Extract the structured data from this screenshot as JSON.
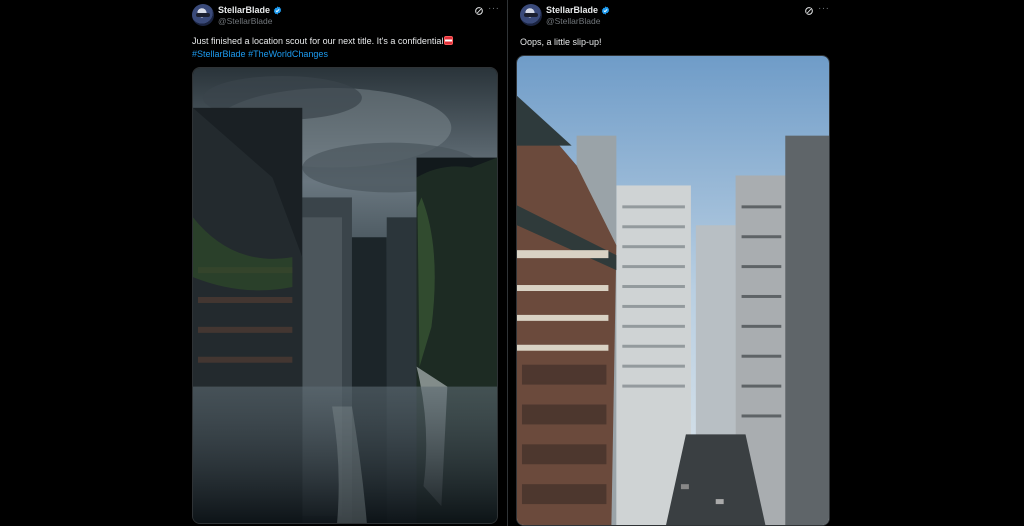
{
  "tweets": [
    {
      "display_name": "StellarBlade",
      "handle": "@StellarBlade",
      "text_line1": "Just finished a location scout for our next title. It's a confidential",
      "hashtags": [
        "#StellarBlade",
        "#TheWorldChanges"
      ],
      "media": {
        "scene": "stormy-ruined-city-canyon"
      }
    },
    {
      "display_name": "StellarBlade",
      "handle": "@StellarBlade",
      "text_line1": "Oops, a little slip-up!",
      "media": {
        "scene": "sunny-city-canyon"
      }
    }
  ],
  "icons": {
    "verified": "verified-badge-icon",
    "grok": "grok-icon",
    "more": "more-icon",
    "flag": "flag-emoji-icon"
  },
  "colors": {
    "background": "#000000",
    "text": "#e7e9ea",
    "secondary": "#71767b",
    "link": "#1d9bf0",
    "divider": "#2f3336"
  }
}
